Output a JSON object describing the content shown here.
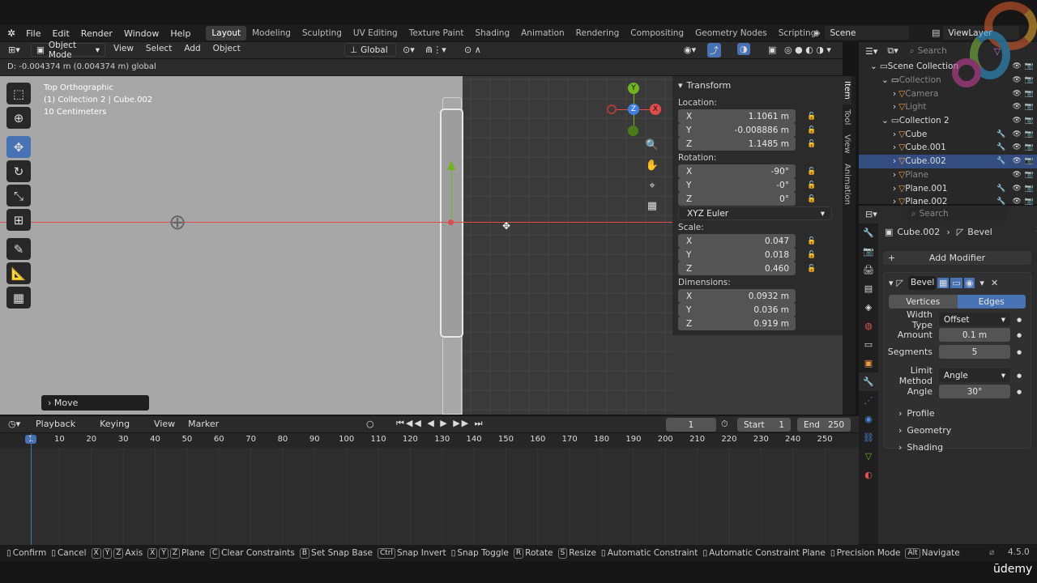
{
  "menu": [
    "File",
    "Edit",
    "Render",
    "Window",
    "Help"
  ],
  "workspaces": [
    "Layout",
    "Modeling",
    "Sculpting",
    "UV Editing",
    "Texture Paint",
    "Shading",
    "Animation",
    "Rendering",
    "Compositing",
    "Geometry Nodes",
    "Scripting"
  ],
  "active_workspace": "Layout",
  "scene_name": "Scene",
  "view_layer": "ViewLayer",
  "viewport": {
    "mode": "Object Mode",
    "menus": [
      "View",
      "Select",
      "Add",
      "Object"
    ],
    "orientation": "Global",
    "op_info": "D: -0.004374 m (0.004374 m) global",
    "view_name": "Top Orthographic",
    "collection_info": "(1) Collection 2 | Cube.002",
    "scale_info": "10 Centimeters",
    "last_op": "Move",
    "gizmo": {
      "y": "Y",
      "z": "Z",
      "x": "X"
    }
  },
  "npanel": {
    "title": "Transform",
    "location_label": "Location:",
    "location": [
      [
        "X",
        "1.1061 m"
      ],
      [
        "Y",
        "-0.008886 m"
      ],
      [
        "Z",
        "1.1485 m"
      ]
    ],
    "rotation_label": "Rotation:",
    "rotation": [
      [
        "X",
        "-90°"
      ],
      [
        "Y",
        "-0°"
      ],
      [
        "Z",
        "0°"
      ]
    ],
    "rotation_mode": "XYZ Euler",
    "scale_label": "Scale:",
    "scale": [
      [
        "X",
        "0.047"
      ],
      [
        "Y",
        "0.018"
      ],
      [
        "Z",
        "0.460"
      ]
    ],
    "dimensions_label": "Dimensions:",
    "dimensions": [
      [
        "X",
        "0.0932 m"
      ],
      [
        "Y",
        "0.036 m"
      ],
      [
        "Z",
        "0.919 m"
      ]
    ],
    "tabs": [
      "Item",
      "Tool",
      "View",
      "Animation"
    ]
  },
  "outliner": {
    "search_placeholder": "Search",
    "rows": [
      {
        "name": "Scene Collection",
        "indent": 0,
        "sel": false,
        "dim": false
      },
      {
        "name": "Collection",
        "indent": 1,
        "sel": false,
        "dim": true
      },
      {
        "name": "Camera",
        "indent": 2,
        "sel": false,
        "dim": true
      },
      {
        "name": "Light",
        "indent": 2,
        "sel": false,
        "dim": true
      },
      {
        "name": "Collection 2",
        "indent": 1,
        "sel": false,
        "dim": false
      },
      {
        "name": "Cube",
        "indent": 2,
        "sel": false,
        "dim": false
      },
      {
        "name": "Cube.001",
        "indent": 2,
        "sel": false,
        "dim": false
      },
      {
        "name": "Cube.002",
        "indent": 2,
        "sel": true,
        "dim": false
      },
      {
        "name": "Plane",
        "indent": 2,
        "sel": false,
        "dim": true
      },
      {
        "name": "Plane.001",
        "indent": 2,
        "sel": false,
        "dim": false
      },
      {
        "name": "Plane.002",
        "indent": 2,
        "sel": false,
        "dim": false
      }
    ]
  },
  "properties": {
    "search_placeholder": "Search",
    "object": "Cube.002",
    "modifier_crumb": "Bevel",
    "add_modifier": "Add Modifier",
    "modifier_name": "Bevel",
    "affect": [
      "Vertices",
      "Edges"
    ],
    "affect_active": "Edges",
    "width_type_label": "Width Type",
    "width_type": "Offset",
    "amount_label": "Amount",
    "amount": "0.1 m",
    "segments_label": "Segments",
    "segments": "5",
    "limit_method_label": "Limit Method",
    "limit_method": "Angle",
    "angle_label": "Angle",
    "angle": "30°",
    "subpanels": [
      "Profile",
      "Geometry",
      "Shading"
    ]
  },
  "timeline": {
    "menus": [
      "Playback",
      "Keying",
      "View",
      "Marker"
    ],
    "current_frame": "1",
    "start_label": "Start",
    "start": "1",
    "end_label": "End",
    "end": "250",
    "ticks": [
      "1",
      "10",
      "20",
      "30",
      "40",
      "50",
      "60",
      "70",
      "80",
      "90",
      "100",
      "110",
      "120",
      "130",
      "140",
      "150",
      "160",
      "170",
      "180",
      "190",
      "200",
      "210",
      "220",
      "230",
      "240",
      "250"
    ]
  },
  "status": [
    {
      "key": "",
      "label": "Confirm"
    },
    {
      "key": "",
      "label": "Cancel"
    },
    {
      "key": "X Y Z",
      "label": "Axis"
    },
    {
      "key": "X Y Z",
      "label": "Plane"
    },
    {
      "key": "C",
      "label": "Clear Constraints"
    },
    {
      "key": "B",
      "label": "Set Snap Base"
    },
    {
      "key": "Ctrl",
      "label": "Snap Invert"
    },
    {
      "key": "",
      "label": "Snap Toggle"
    },
    {
      "key": "R",
      "label": "Rotate"
    },
    {
      "key": "S",
      "label": "Resize"
    },
    {
      "key": "",
      "label": "Automatic Constraint"
    },
    {
      "key": "",
      "label": "Automatic Constraint Plane"
    },
    {
      "key": "",
      "label": "Precision Mode"
    },
    {
      "key": "Alt",
      "label": "Navigate"
    }
  ],
  "version": "4.5.0",
  "watermark": "ūdemy",
  "colors": {
    "accent": "#4772b3",
    "selected_row": "#334d80",
    "x_axis": "#e04b4b",
    "y_axis": "#6fb51f",
    "z_axis": "#3b7fe0"
  }
}
